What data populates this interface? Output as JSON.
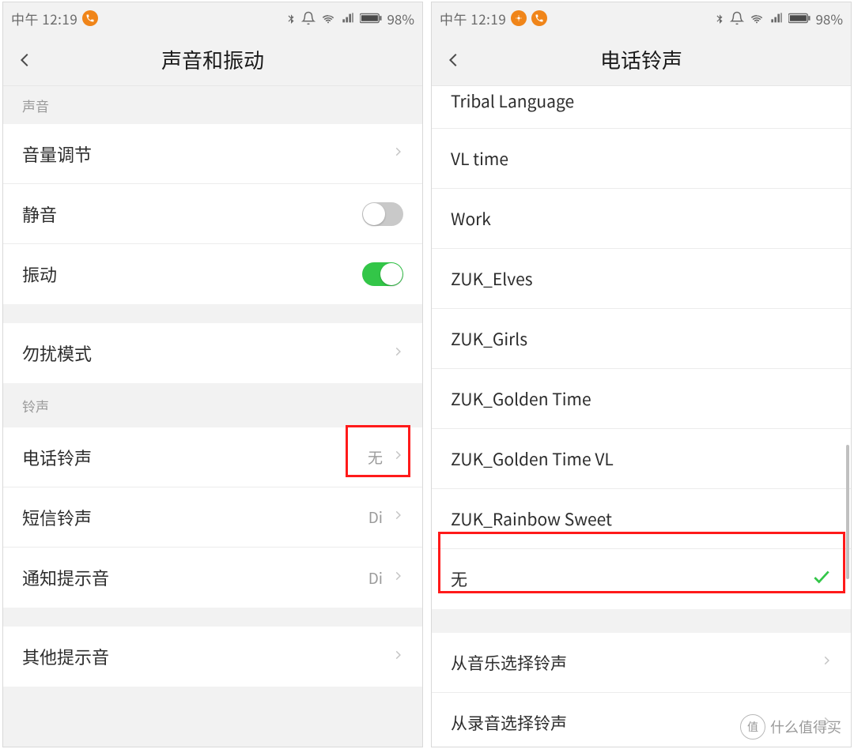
{
  "status": {
    "time": "中午 12:19",
    "battery_pct": "98%",
    "bt_icon": "bluetooth-icon",
    "alarm_icon": "alarm-icon",
    "wifi_icon": "wifi-icon",
    "signal_icon": "signal-icon",
    "battery_icon": "battery-icon"
  },
  "left": {
    "title": "声音和振动",
    "section_sound": "声音",
    "volume_row": "音量调节",
    "mute_row": "静音",
    "vibrate_row": "振动",
    "dnd_row": "勿扰模式",
    "section_ring": "铃声",
    "phone_ring_row": "电话铃声",
    "phone_ring_value": "无",
    "sms_row": "短信铃声",
    "sms_value": "Di",
    "notify_row": "通知提示音",
    "notify_value": "Di",
    "other_row": "其他提示音"
  },
  "right": {
    "title": "电话铃声",
    "items": [
      "Tribal Language",
      "VL time",
      "Work",
      "ZUK_Elves",
      "ZUK_Girls",
      "ZUK_Golden Time",
      "ZUK_Golden Time VL",
      "ZUK_Rainbow Sweet"
    ],
    "selected": "无",
    "from_music": "从音乐选择铃声",
    "from_record": "从录音选择铃声"
  },
  "watermark": {
    "badge": "值",
    "text": "什么值得买"
  }
}
